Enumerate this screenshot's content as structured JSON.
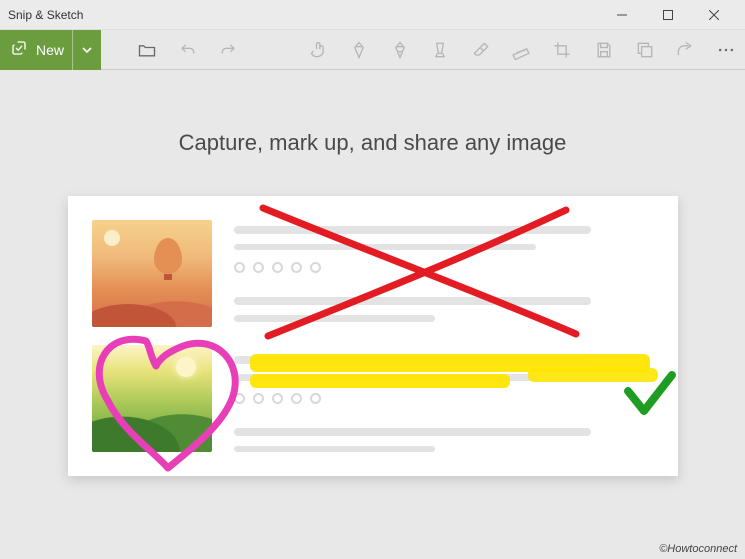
{
  "titlebar": {
    "title": "Snip & Sketch"
  },
  "toolbar": {
    "new_label": "New",
    "icons": {
      "snip": "snip-icon",
      "open": "open-icon",
      "undo": "undo-icon",
      "redo": "redo-icon",
      "touch": "touch-writing-icon",
      "pen": "ballpoint-pen-icon",
      "pencil": "pencil-icon",
      "highlighter": "highlighter-icon",
      "eraser": "eraser-icon",
      "ruler": "ruler-icon",
      "crop": "crop-icon",
      "save": "save-icon",
      "copy": "copy-icon",
      "share": "share-icon",
      "more": "more-icon"
    }
  },
  "main": {
    "headline": "Capture, mark up, and share any image"
  },
  "watermark": {
    "text": "©Howtoconnect"
  },
  "colors": {
    "accent": "#6b9d3e",
    "cross": "#e31b23",
    "heart": "#e83fb9",
    "highlight": "#ffe500",
    "check": "#1f9d22"
  }
}
